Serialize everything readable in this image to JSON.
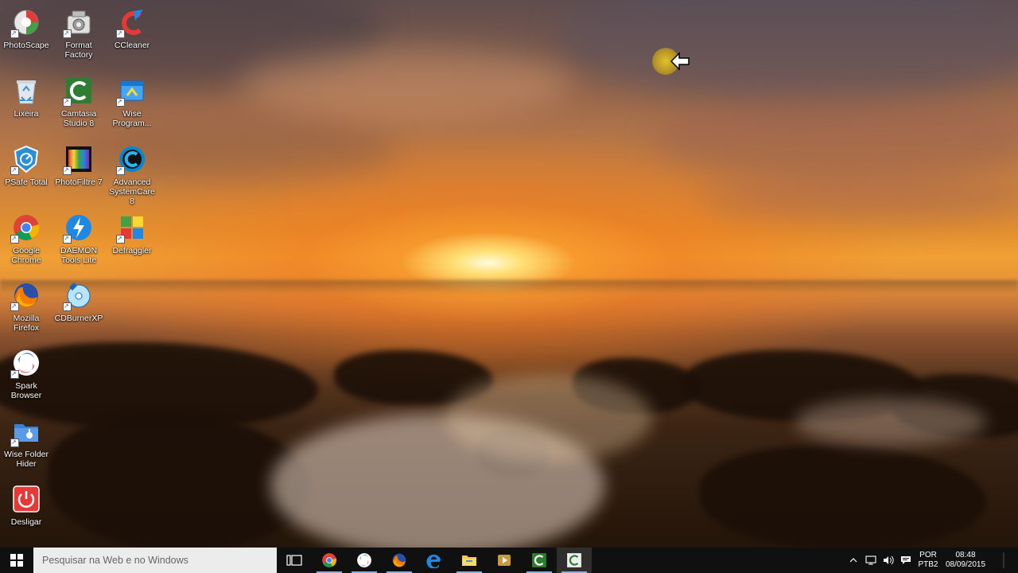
{
  "desktop": {
    "columns": [
      [
        {
          "label": "PhotoScape",
          "icon": "photoscape-icon"
        },
        {
          "label": "Lixeira",
          "icon": "recycle-bin-icon"
        },
        {
          "label": "PSafe Total",
          "icon": "psafe-icon"
        },
        {
          "label": "Google Chrome",
          "icon": "chrome-icon"
        },
        {
          "label": "Mozilla Firefox",
          "icon": "firefox-icon"
        },
        {
          "label": "Spark Browser",
          "icon": "spark-icon"
        },
        {
          "label": "Wise Folder Hider",
          "icon": "folder-hider-icon"
        },
        {
          "label": "Desligar",
          "icon": "power-icon"
        }
      ],
      [
        {
          "label": "Format Factory",
          "icon": "format-factory-icon"
        },
        {
          "label": "Camtasia Studio 8",
          "icon": "camtasia-icon"
        },
        {
          "label": "PhotoFiltre 7",
          "icon": "photofiltre-icon"
        },
        {
          "label": "DAEMON Tools Lite",
          "icon": "daemon-tools-icon"
        },
        {
          "label": "CDBurnerXP",
          "icon": "cdburner-icon"
        }
      ],
      [
        {
          "label": "CCleaner",
          "icon": "ccleaner-icon"
        },
        {
          "label": "Wise Program...",
          "icon": "wise-program-icon"
        },
        {
          "label": "Advanced SystemCare 8",
          "icon": "advanced-systemcare-icon"
        },
        {
          "label": "Defraggler",
          "icon": "defraggler-icon"
        }
      ]
    ]
  },
  "taskbar": {
    "search_placeholder": "Pesquisar na Web e no Windows",
    "pinned": [
      {
        "name": "task-view",
        "icon": "task-view-icon"
      },
      {
        "name": "chrome",
        "icon": "chrome-icon"
      },
      {
        "name": "spark",
        "icon": "spark-icon"
      },
      {
        "name": "firefox",
        "icon": "firefox-icon"
      },
      {
        "name": "edge",
        "icon": "edge-icon"
      },
      {
        "name": "file-explorer",
        "icon": "folder-icon"
      },
      {
        "name": "media-player",
        "icon": "media-player-icon"
      },
      {
        "name": "camtasia",
        "icon": "camtasia-icon"
      },
      {
        "name": "camtasia-recorder",
        "icon": "camtasia-icon"
      }
    ],
    "tray": {
      "lang_top": "POR",
      "lang_bottom": "PTB2",
      "time": "08:48",
      "date": "08/09/2015"
    }
  },
  "colors": {
    "taskbar": "#101010",
    "search_bg": "#ececec",
    "active_indicator": "#7fb3e8"
  }
}
